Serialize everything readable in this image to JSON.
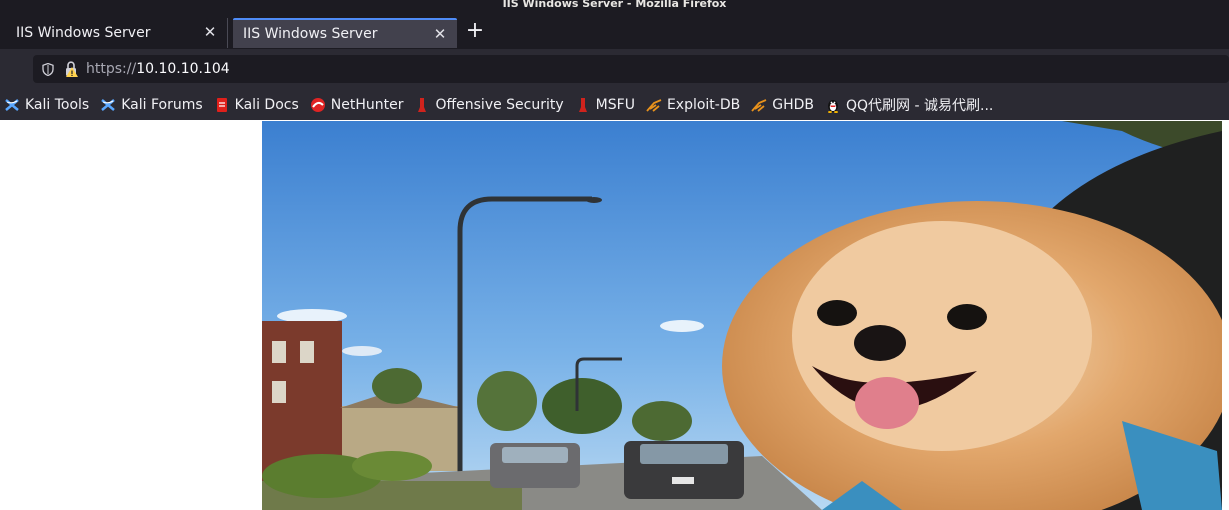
{
  "window": {
    "title": "IIS Windows Server - Mozilla Firefox"
  },
  "tabs": [
    {
      "label": "IIS Windows Server",
      "active": false
    },
    {
      "label": "IIS Windows Server",
      "active": true
    }
  ],
  "toolbar": {
    "new_tab": "+",
    "close": "✕"
  },
  "address_bar": {
    "protocol": "https://",
    "host": "10.10.10.104"
  },
  "bookmarks": [
    {
      "label": "Kali Tools",
      "icon": "kali-icon"
    },
    {
      "label": "Kali Forums",
      "icon": "kali-icon"
    },
    {
      "label": "Kali Docs",
      "icon": "kali-docs-icon"
    },
    {
      "label": "NetHunter",
      "icon": "nethunter-icon"
    },
    {
      "label": "Offensive Security",
      "icon": "offsec-icon"
    },
    {
      "label": "MSFU",
      "icon": "offsec-icon"
    },
    {
      "label": "Exploit-DB",
      "icon": "exploitdb-icon"
    },
    {
      "label": "GHDB",
      "icon": "exploitdb-icon"
    },
    {
      "label": "QQ代刷网 - 诚易代刷...",
      "icon": "qq-penguin-icon"
    }
  ],
  "colors": {
    "accent": "#4f8cf7",
    "chrome_dark": "#1c1b22",
    "chrome": "#2b2a33"
  }
}
